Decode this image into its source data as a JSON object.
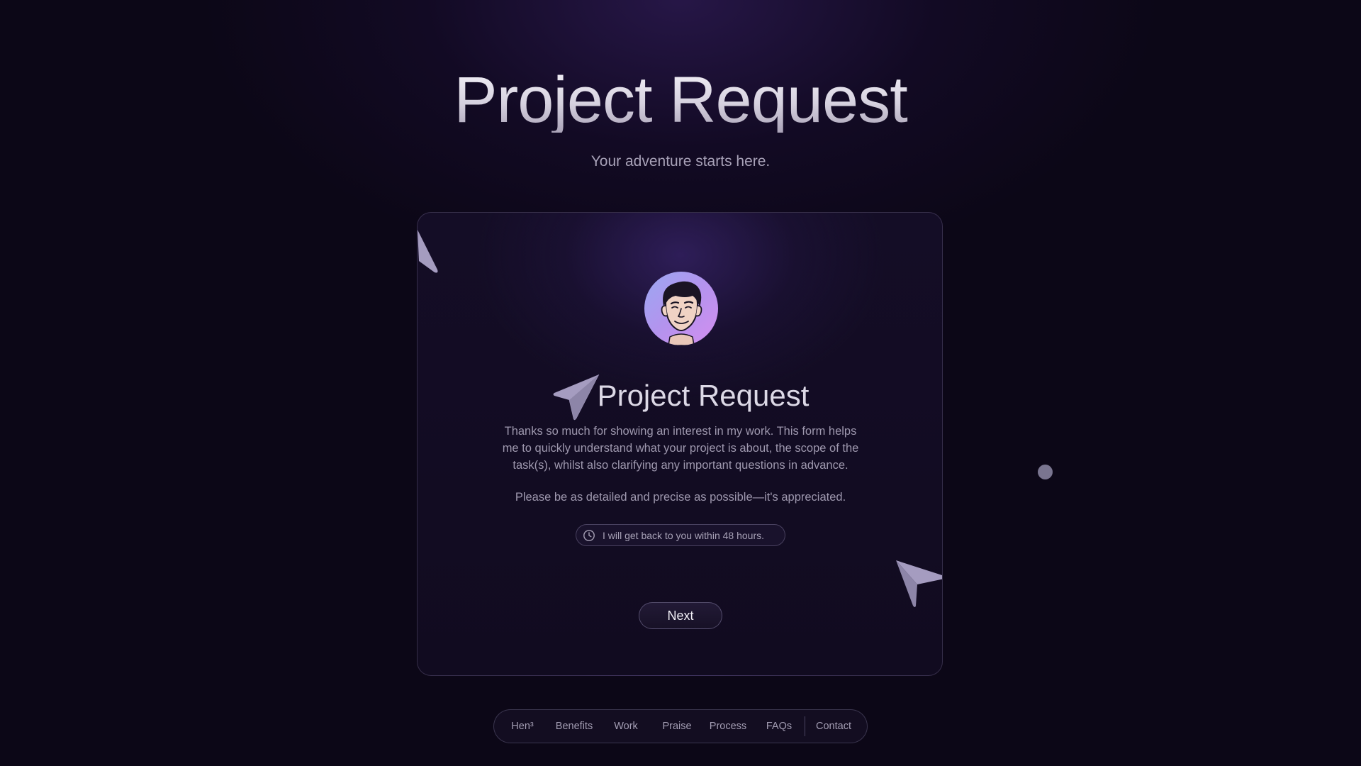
{
  "hero": {
    "title": "Project Request",
    "subtitle": "Your adventure starts here."
  },
  "card": {
    "title": "Project Request",
    "description": "Thanks so much for showing an interest in my work. This form helps me to quickly understand what your project is about, the scope of the task(s), whilst also clarifying any important questions in advance.",
    "note": "Please be as detailed and precise as possible—it's appreciated.",
    "response_time": "I will get back to you within 48 hours.",
    "next_label": "Next"
  },
  "nav": {
    "items": [
      {
        "label": "Hen³"
      },
      {
        "label": "Benefits"
      },
      {
        "label": "Work"
      },
      {
        "label": "Praise"
      },
      {
        "label": "Process"
      },
      {
        "label": "FAQs"
      },
      {
        "label": "Contact"
      }
    ]
  },
  "colors": {
    "background": "#0c0717",
    "card_background": "#130c24",
    "avatar_gradient_start": "#9aa8f2",
    "avatar_gradient_end": "#d48ff0",
    "plane_icon": "#a59cc0",
    "text_muted": "#9e98ae"
  },
  "icons": {
    "title_icon": "paper-plane-icon",
    "pill_icon": "clock-icon",
    "decorations": [
      "paper-plane-icon",
      "paper-plane-icon",
      "dot"
    ]
  }
}
